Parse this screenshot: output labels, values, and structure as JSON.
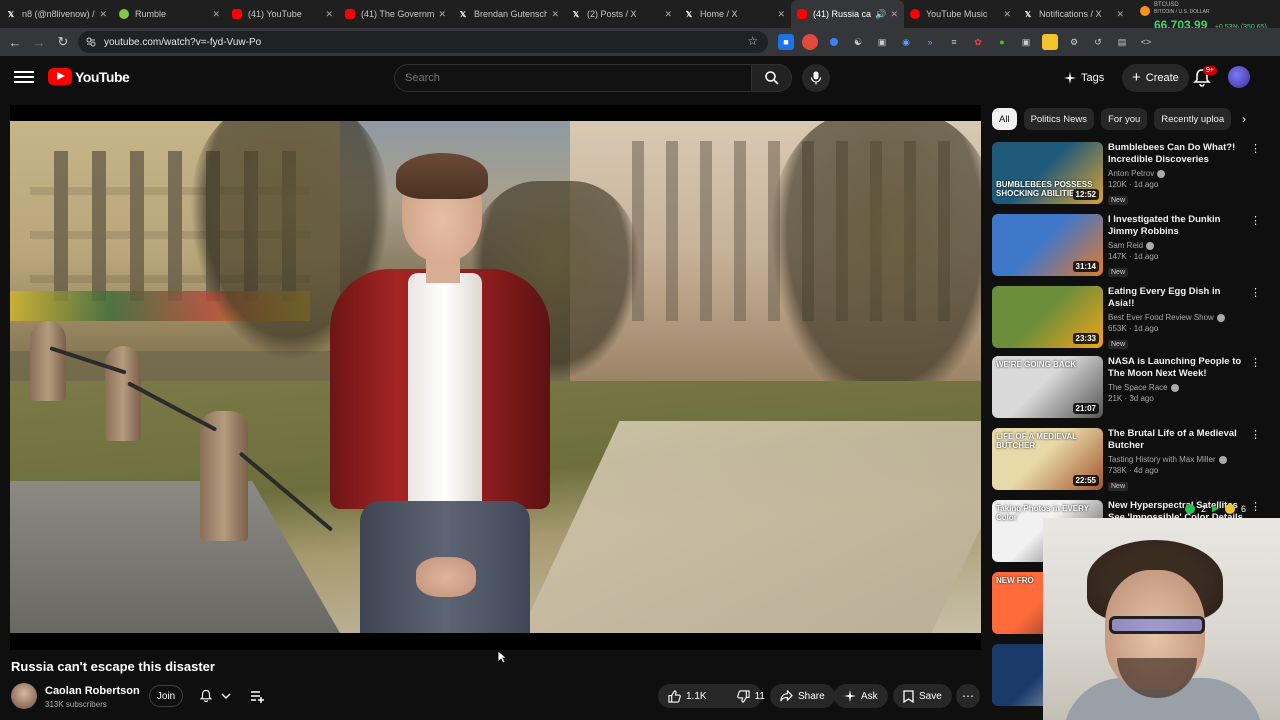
{
  "browser": {
    "tabs": [
      {
        "title": "n8 (@n8livenow) /",
        "icon": "x-logo",
        "active": false
      },
      {
        "title": "Rumble",
        "icon": "rumble-logo",
        "active": false
      },
      {
        "title": "(41) YouTube",
        "icon": "youtube-logo",
        "active": false
      },
      {
        "title": "(41) The Governm",
        "icon": "youtube-logo",
        "active": false
      },
      {
        "title": "Brendan Gutensch",
        "icon": "x-logo",
        "active": false
      },
      {
        "title": "(2) Posts / X",
        "icon": "x-logo",
        "active": false
      },
      {
        "title": "Home / X",
        "icon": "x-logo",
        "active": false
      },
      {
        "title": "(41) Russia ca",
        "icon": "youtube-logo",
        "active": true
      },
      {
        "title": "YouTube Music",
        "icon": "youtube-music-logo",
        "active": false
      },
      {
        "title": "Notifications / X",
        "icon": "x-logo",
        "active": false
      }
    ],
    "ticker": {
      "symbol": "BTCUSD",
      "name": "BITCOIN / U.S. DOLLAR",
      "price": "66,703.99",
      "change": "+0.53% (350.65)",
      "color": "#3fd46b"
    },
    "url": "youtube.com/watch?v=-fyd-Vuw-Po"
  },
  "header": {
    "logo_text": "YouTube",
    "search_placeholder": "Search",
    "tags_label": "Tags",
    "create_label": "Create",
    "notifications_badge": "9+"
  },
  "video": {
    "title": "Russia can't escape this disaster",
    "channel": {
      "name": "Caolan Robertson",
      "subscribers": "313K subscribers"
    },
    "join_label": "Join",
    "likes": "1.1K",
    "dislikes": "11",
    "share_label": "Share",
    "ask_label": "Ask",
    "save_label": "Save"
  },
  "sidebar": {
    "chips": [
      {
        "label": "All",
        "active": true
      },
      {
        "label": "Politics News",
        "active": false
      },
      {
        "label": "For you",
        "active": false
      },
      {
        "label": "Recently uploa",
        "active": false
      }
    ],
    "recommendations": [
      {
        "title": "Bumblebees Can Do What?! Incredible Discoveries Nobody...",
        "channel": "Anton Petrov",
        "verified": true,
        "stats": "120K · 1d ago",
        "badge": "New",
        "duration": "12:52",
        "thumb_text": "BUMBLEBEES POSSESS SHOCKING ABILITIES",
        "thumb_colors": [
          "#1f5a7a",
          "#d9a433"
        ]
      },
      {
        "title": "I Investigated the Dunkin Jimmy Robbins",
        "channel": "Sam Reid",
        "verified": true,
        "stats": "147K · 1d ago",
        "badge": "New",
        "duration": "31:14",
        "thumb_text": "",
        "thumb_colors": [
          "#3f78c9",
          "#e07a2e"
        ]
      },
      {
        "title": "Eating Every Egg Dish in Asia!!",
        "channel": "Best Ever Food Review Show",
        "verified": true,
        "stats": "653K · 1d ago",
        "badge": "New",
        "duration": "23:33",
        "thumb_text": "",
        "thumb_colors": [
          "#6a8e3a",
          "#f2a31a"
        ]
      },
      {
        "title": "NASA is Launching People to The Moon Next Week!",
        "channel": "The Space Race",
        "verified": true,
        "stats": "21K · 3d ago",
        "badge": "",
        "duration": "21:07",
        "thumb_text": "WE'RE GOING BACK",
        "thumb_colors": [
          "#d9d9d9",
          "#555555"
        ]
      },
      {
        "title": "The Brutal Life of a Medieval Butcher",
        "channel": "Tasting History with Max Miller",
        "verified": true,
        "stats": "738K · 4d ago",
        "badge": "New",
        "duration": "22:55",
        "thumb_text": "LIFE OF A MEDIEVAL BUTCHER",
        "thumb_colors": [
          "#e8d9a8",
          "#a3542c"
        ]
      },
      {
        "title": "New Hyperspectral Satellites See 'Impossible' Color Details",
        "channel": "",
        "verified": false,
        "stats": "",
        "badge": "",
        "duration": "",
        "thumb_text": "Taking Photos in EVERY Color",
        "thumb_colors": [
          "#f1f1f1",
          "#444444"
        ]
      },
      {
        "title": "",
        "channel": "",
        "verified": false,
        "stats": "",
        "badge": "",
        "duration": "",
        "thumb_text": "NEW FRO",
        "thumb_colors": [
          "#ff6b3a",
          "#222222"
        ]
      },
      {
        "title": "",
        "channel": "",
        "verified": false,
        "stats": "",
        "badge": "",
        "duration": "",
        "thumb_text": "",
        "thumb_colors": [
          "#1a3a6a",
          "#d0d0d0"
        ]
      }
    ]
  },
  "overlay": {
    "badge_count": "2",
    "extra": "6"
  }
}
